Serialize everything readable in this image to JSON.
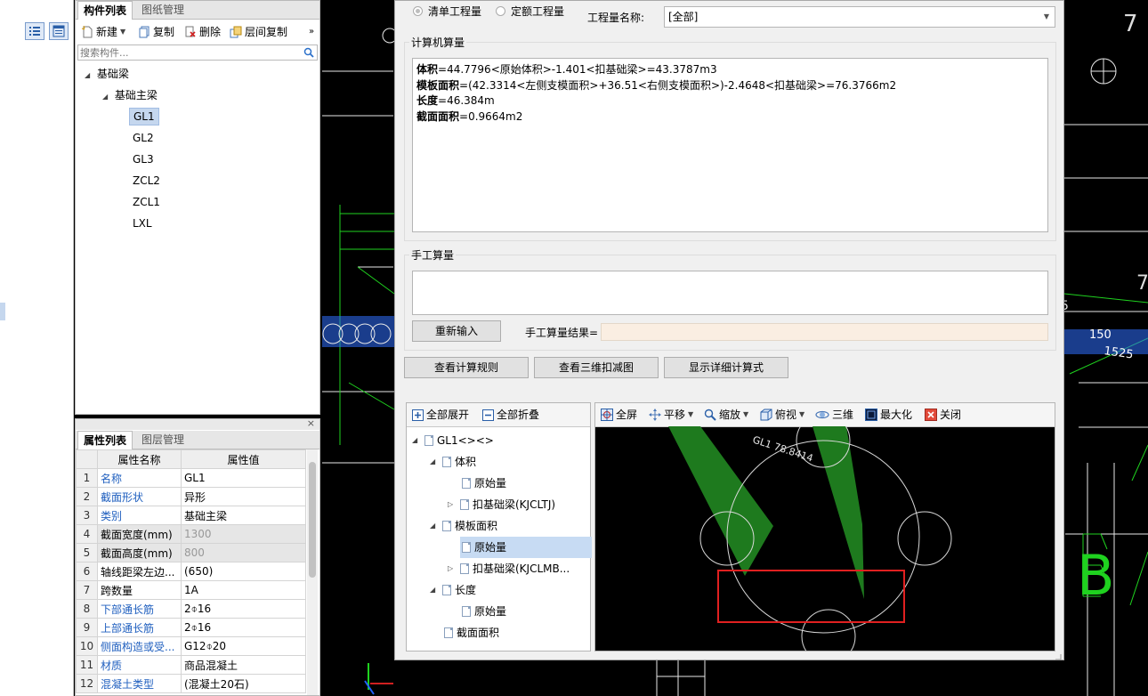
{
  "component_panel": {
    "tabs": [
      "构件列表",
      "图纸管理"
    ],
    "toolbar": {
      "new": "新建",
      "copy": "复制",
      "delete": "删除",
      "floor_copy": "层间复制"
    },
    "search_placeholder": "搜索构件...",
    "tree": {
      "root": "基础梁",
      "child": "基础主梁",
      "leaves": [
        "GL1",
        "GL2",
        "GL3",
        "ZCL2",
        "ZCL1",
        "LXL"
      ],
      "selected": "GL1"
    }
  },
  "property_panel": {
    "tabs": [
      "属性列表",
      "图层管理"
    ],
    "headers": [
      "属性名称",
      "属性值"
    ],
    "rows": [
      {
        "no": "1",
        "name": "名称",
        "value": "GL1"
      },
      {
        "no": "2",
        "name": "截面形状",
        "value": "异形"
      },
      {
        "no": "3",
        "name": "类别",
        "value": "基础主梁"
      },
      {
        "no": "4",
        "name": "截面宽度(mm)",
        "value": "1300"
      },
      {
        "no": "5",
        "name": "截面高度(mm)",
        "value": "800"
      },
      {
        "no": "6",
        "name": "轴线距梁左边...",
        "value": "(650)"
      },
      {
        "no": "7",
        "name": "跨数量",
        "value": "1A"
      },
      {
        "no": "8",
        "name": "下部通长筋",
        "value": "2⌽16"
      },
      {
        "no": "9",
        "name": "上部通长筋",
        "value": "2⌽16"
      },
      {
        "no": "10",
        "name": "侧面构造或受...",
        "value": "G12⌽20"
      },
      {
        "no": "11",
        "name": "材质",
        "value": "商品混凝土"
      },
      {
        "no": "12",
        "name": "混凝土类型",
        "value": "(混凝土20石)"
      }
    ]
  },
  "dialog": {
    "radio_bill": "清单工程量",
    "radio_quota": "定额工程量",
    "quantity_name_label": "工程量名称:",
    "quantity_name_value": "[全部]",
    "computer_calc_title": "计算机算量",
    "calc_lines": [
      {
        "key": "体积",
        "expr": "=44.7796<原始体积>-1.401<扣基础梁>=43.3787m3"
      },
      {
        "key": "模板面积",
        "expr": "=(42.3314<左侧支模面积>+36.51<右侧支模面积>)-2.4648<扣基础梁>=76.3766m2"
      },
      {
        "key": "长度",
        "expr": "=46.384m"
      },
      {
        "key": "截面面积",
        "expr": "=0.9664m2"
      }
    ],
    "manual_calc_title": "手工算量",
    "reinput_button": "重新输入",
    "manual_result_label": "手工算量结果=",
    "view_rules_button": "查看计算规则",
    "view_3d_button": "查看三维扣减图",
    "show_detail_button": "显示详细计算式",
    "tree_toolbar": {
      "expand_all": "全部展开",
      "collapse_all": "全部折叠"
    },
    "deduct_tree": {
      "root": "GL1<><>",
      "volume": "体积",
      "volume_original": "原始量",
      "volume_deduct": "扣基础梁(KJCLTJ)",
      "formwork": "模板面积",
      "formwork_original": "原始量",
      "formwork_deduct": "扣基础梁(KJCLMB...",
      "length": "长度",
      "length_original": "原始量",
      "section": "截面面积"
    },
    "view_toolbar": {
      "fullscreen": "全屏",
      "pan": "平移",
      "zoom": "缩放",
      "topview": "俯视",
      "threed": "三维",
      "maximize": "最大化",
      "close": "关闭"
    },
    "view_label": "GL1 78.8414"
  },
  "cad": {
    "dim_150": "150",
    "dim_1525": "1525",
    "letter_b": "B",
    "num_7": "7",
    "num_5": "5"
  },
  "colors": {
    "cad_background": "#000000",
    "green_line": "#1fd21f",
    "highlight_red": "#e02020",
    "beam_green": "#1e7a1e",
    "selected_blue": "#c5d7ee",
    "link_blue": "#1f5fbf"
  }
}
